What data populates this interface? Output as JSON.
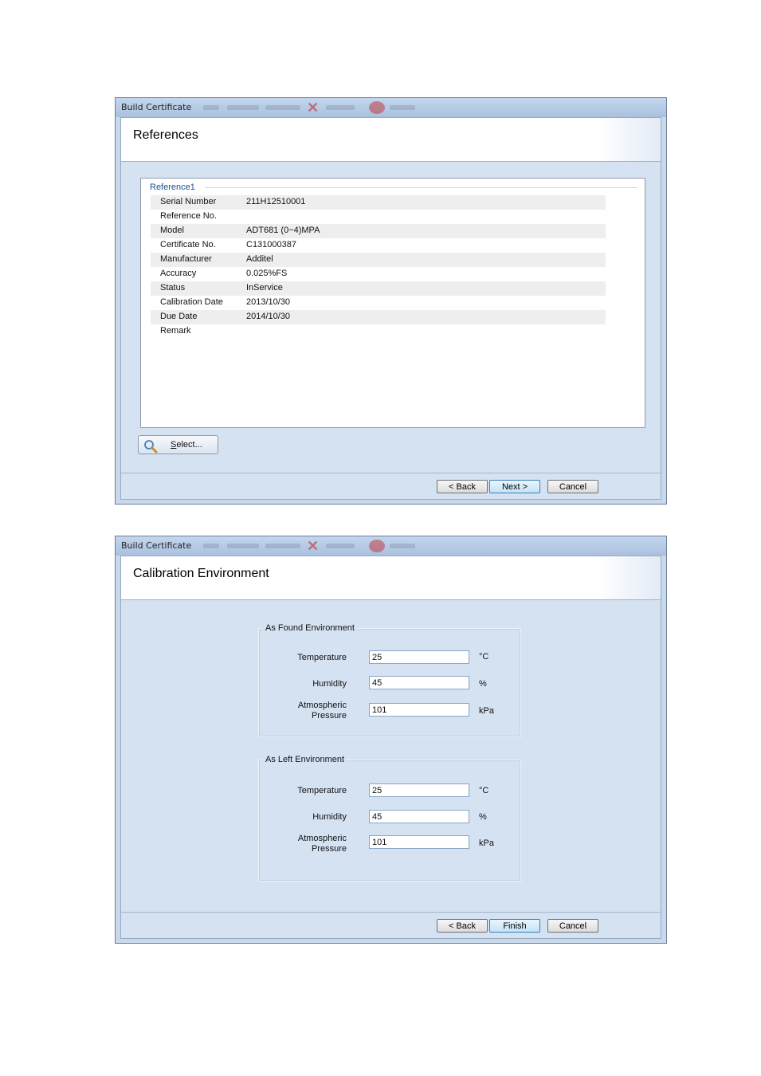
{
  "window1": {
    "title": "Build Certificate",
    "header_title": "References",
    "group_label": "Reference1",
    "properties": [
      {
        "name": "Serial Number",
        "value": "211H12510001"
      },
      {
        "name": "Reference No.",
        "value": ""
      },
      {
        "name": "Model",
        "value": "ADT681 (0~4)MPA"
      },
      {
        "name": "Certificate No.",
        "value": "C131000387"
      },
      {
        "name": "Manufacturer",
        "value": "Additel"
      },
      {
        "name": "Accuracy",
        "value": "0.025%FS"
      },
      {
        "name": "Status",
        "value": "InService"
      },
      {
        "name": "Calibration Date",
        "value": "2013/10/30"
      },
      {
        "name": "Due Date",
        "value": "2014/10/30"
      },
      {
        "name": "Remark",
        "value": ""
      }
    ],
    "select_button": {
      "accel": "S",
      "rest": "elect..."
    },
    "buttons": {
      "back": "< Back",
      "next": "Next >",
      "cancel": "Cancel"
    }
  },
  "window2": {
    "title": "Build Certificate",
    "header_title": "Calibration Environment",
    "as_found": {
      "label": "As Found Environment",
      "temperature_label": "Temperature",
      "temperature_value": "25",
      "temperature_unit": "°C",
      "humidity_label": "Humidity",
      "humidity_value": "45",
      "humidity_unit": "%",
      "pressure_label_1": "Atmospheric",
      "pressure_label_2": "Pressure",
      "pressure_value": "101",
      "pressure_unit": "kPa"
    },
    "as_left": {
      "label": "As Left Environment",
      "temperature_label": "Temperature",
      "temperature_value": "25",
      "temperature_unit": "°C",
      "humidity_label": "Humidity",
      "humidity_value": "45",
      "humidity_unit": "%",
      "pressure_label_1": "Atmospheric",
      "pressure_label_2": "Pressure",
      "pressure_value": "101",
      "pressure_unit": "kPa"
    },
    "buttons": {
      "back": "< Back",
      "finish": "Finish",
      "cancel": "Cancel"
    }
  },
  "icons": [
    "magnifier-icon",
    "delete-icon",
    "close-icon"
  ],
  "colors": {
    "window_bg": "#c9d9ec",
    "client_bg": "#d5e2f2",
    "group_label": "#1b4f9c",
    "default_button_border": "#3c7fb1"
  }
}
